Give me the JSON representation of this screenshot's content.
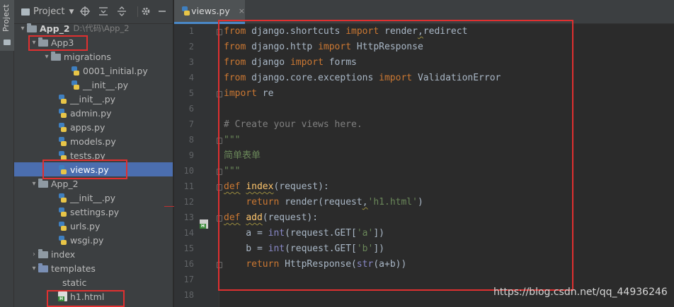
{
  "tool_stripe": {
    "project_tab_label": "Project"
  },
  "project_panel": {
    "title": "Project",
    "icons": [
      "crosshair-icon",
      "collapse-icon",
      "expand-icon",
      "gear-icon",
      "minimize-icon"
    ],
    "tree": [
      {
        "label": "App_2",
        "path": "D:\\代码\\App_2",
        "kind": "folder",
        "depth": 0,
        "expanded": true,
        "bold": true
      },
      {
        "label": "App3",
        "kind": "folder",
        "depth": 1,
        "expanded": true
      },
      {
        "label": "migrations",
        "kind": "folder",
        "depth": 2,
        "expanded": true
      },
      {
        "label": "0001_initial.py",
        "kind": "py",
        "depth": 3
      },
      {
        "label": "__init__.py",
        "kind": "py",
        "depth": 3
      },
      {
        "label": "__init__.py",
        "kind": "py",
        "depth": 2
      },
      {
        "label": "admin.py",
        "kind": "py",
        "depth": 2
      },
      {
        "label": "apps.py",
        "kind": "py",
        "depth": 2
      },
      {
        "label": "models.py",
        "kind": "py",
        "depth": 2
      },
      {
        "label": "tests.py",
        "kind": "py",
        "depth": 2
      },
      {
        "label": "views.py",
        "kind": "py",
        "depth": 2,
        "selected": true
      },
      {
        "label": "App_2",
        "kind": "folder",
        "depth": 1,
        "expanded": true
      },
      {
        "label": "__init__.py",
        "kind": "py",
        "depth": 2
      },
      {
        "label": "settings.py",
        "kind": "py",
        "depth": 2
      },
      {
        "label": "urls.py",
        "kind": "py",
        "depth": 2
      },
      {
        "label": "wsgi.py",
        "kind": "py",
        "depth": 2
      },
      {
        "label": "index",
        "kind": "folder",
        "depth": 1,
        "expanded": false
      },
      {
        "label": "templates",
        "kind": "folder-blue",
        "depth": 1,
        "expanded": true
      },
      {
        "label": "static",
        "kind": "none",
        "depth": 2
      },
      {
        "label": "h1.html",
        "kind": "html",
        "depth": 2
      }
    ]
  },
  "editor": {
    "tab": {
      "label": "views.py",
      "close": "×"
    },
    "line_numbers": [
      "1",
      "2",
      "3",
      "4",
      "5",
      "6",
      "7",
      "8",
      "9",
      "10",
      "11",
      "12",
      "13",
      "14",
      "15",
      "16",
      "17",
      "18"
    ],
    "lines": [
      [
        [
          "kw",
          "from"
        ],
        [
          "t",
          " django.shortcuts "
        ],
        [
          "kw",
          "import"
        ],
        [
          "t",
          " render"
        ],
        [
          "w",
          ","
        ],
        [
          "t",
          "redirect"
        ]
      ],
      [
        [
          "kw",
          "from"
        ],
        [
          "t",
          " django.http "
        ],
        [
          "kw",
          "import"
        ],
        [
          "t",
          " HttpResponse"
        ]
      ],
      [
        [
          "kw",
          "from"
        ],
        [
          "t",
          " django "
        ],
        [
          "kw",
          "import"
        ],
        [
          "t",
          " forms"
        ]
      ],
      [
        [
          "kw",
          "from"
        ],
        [
          "t",
          " django.core.exceptions "
        ],
        [
          "kw",
          "import"
        ],
        [
          "t",
          " ValidationError"
        ]
      ],
      [
        [
          "kw",
          "import"
        ],
        [
          "t",
          " re"
        ]
      ],
      [],
      [
        [
          "cm",
          "# Create your views here."
        ]
      ],
      [
        [
          "str",
          "\"\"\""
        ]
      ],
      [
        [
          "str",
          "简单表单"
        ]
      ],
      [
        [
          "str",
          "\"\"\""
        ]
      ],
      [
        [
          "kwv",
          "def"
        ],
        [
          "t",
          " "
        ],
        [
          "fnv",
          "index"
        ],
        [
          "t",
          "(request):"
        ]
      ],
      [
        [
          "t",
          "    "
        ],
        [
          "kw",
          "return"
        ],
        [
          "t",
          " render(request"
        ],
        [
          "w",
          ","
        ],
        [
          "str",
          "'h1.html'"
        ],
        [
          "t",
          ")"
        ]
      ],
      [
        [
          "kwv",
          "def"
        ],
        [
          "t",
          " "
        ],
        [
          "fnv",
          "add"
        ],
        [
          "t",
          "(request):"
        ]
      ],
      [
        [
          "t",
          "    a = "
        ],
        [
          "bi",
          "int"
        ],
        [
          "t",
          "(request.GET["
        ],
        [
          "str",
          "'a'"
        ],
        [
          "t",
          "])"
        ]
      ],
      [
        [
          "t",
          "    b = "
        ],
        [
          "bi",
          "int"
        ],
        [
          "t",
          "(request.GET["
        ],
        [
          "str",
          "'b'"
        ],
        [
          "t",
          "])"
        ]
      ],
      [
        [
          "t",
          "    "
        ],
        [
          "kw",
          "return"
        ],
        [
          "t",
          " HttpResponse("
        ],
        [
          "bi",
          "str"
        ],
        [
          "t",
          "(a+b))"
        ]
      ],
      [],
      []
    ]
  },
  "watermark": "https://blog.csdn.net/qq_44936246"
}
